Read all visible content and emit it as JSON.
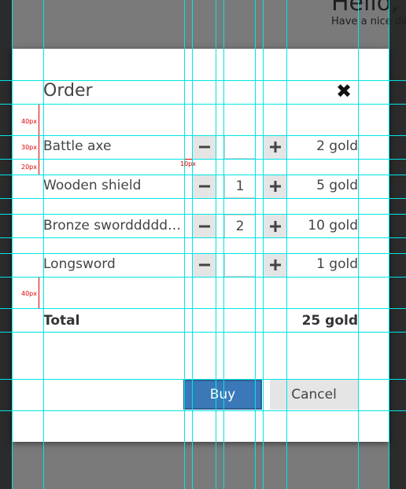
{
  "background": {
    "greeting": "Hello,",
    "subtext": "Have a nice day"
  },
  "dialog": {
    "title": "Order",
    "close_icon": "close-icon",
    "items": [
      {
        "name": "Battle axe",
        "quantity": "",
        "price": "2 gold"
      },
      {
        "name": "Wooden shield",
        "quantity": "1",
        "price": "5 gold"
      },
      {
        "name": "Bronze sworddddddddd",
        "quantity": "2",
        "price": "10 gold"
      },
      {
        "name": "Longsword",
        "quantity": "",
        "price": "1 gold"
      }
    ],
    "total_label": "Total",
    "total_value": "25 gold",
    "buy_label": "Buy",
    "cancel_label": "Cancel"
  },
  "annotations": [
    "40px",
    "30px",
    "20px",
    "10px",
    "40px"
  ],
  "colors": {
    "primary": "#3a78b7",
    "guide": "#00e5e5",
    "annotation": "#e00000"
  }
}
